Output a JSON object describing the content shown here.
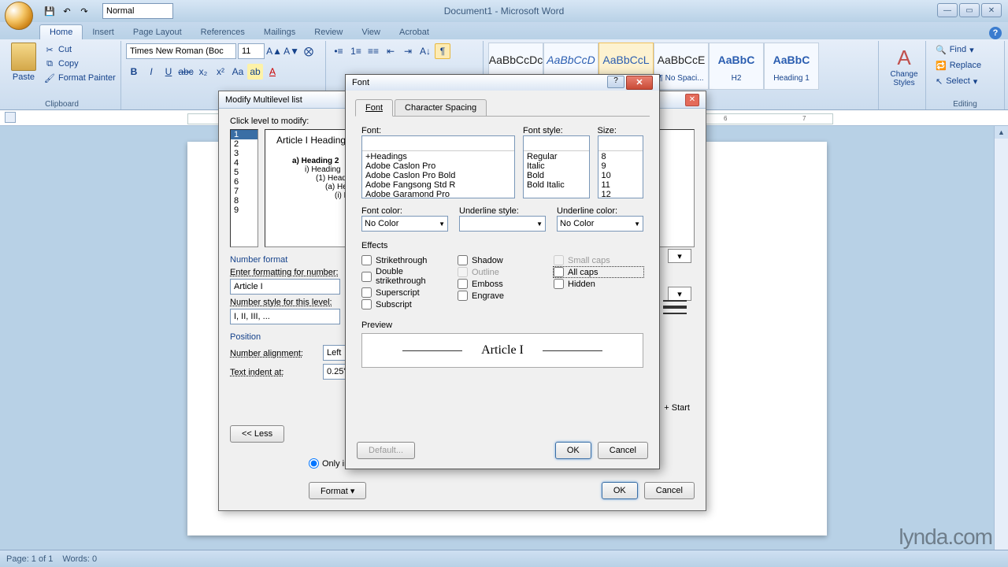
{
  "app": {
    "title": "Document1 - Microsoft Word",
    "qat_style": "Normal"
  },
  "tabs": [
    "Home",
    "Insert",
    "Page Layout",
    "References",
    "Mailings",
    "Review",
    "View",
    "Acrobat"
  ],
  "ribbon": {
    "paste": "Paste",
    "cut": "Cut",
    "copy": "Copy",
    "format_painter": "Format Painter",
    "clipboard": "Clipboard",
    "font_name": "Times New Roman (Boc",
    "font_size": "11",
    "styles": [
      {
        "preview": "AaBbCcDc",
        "name": "",
        "selected": false
      },
      {
        "preview": "AaBbCcD",
        "name": "",
        "selected": false,
        "color": "#2a5db0"
      },
      {
        "preview": "AaBbCcL",
        "name": "",
        "selected": true,
        "color": "#2a5db0"
      },
      {
        "preview": "AaBbCcE",
        "name": "¶ No Spaci...",
        "selected": false
      },
      {
        "preview": "AaBbC",
        "name": "H2",
        "selected": false,
        "color": "#2a5db0"
      },
      {
        "preview": "AaBbC",
        "name": "Heading 1",
        "selected": false,
        "color": "#2a5db0"
      }
    ],
    "change_styles": "Change Styles",
    "find": "Find",
    "replace": "Replace",
    "select": "Select",
    "editing": "Editing"
  },
  "status": {
    "page": "Page: 1 of 1",
    "words": "Words: 0"
  },
  "ml_dialog": {
    "title": "Modify Multilevel list",
    "click_level": "Click level to modify:",
    "levels": [
      "1",
      "2",
      "3",
      "4",
      "5",
      "6",
      "7",
      "8",
      "9"
    ],
    "preview_lines": [
      "Article I Heading 1",
      "a) Heading 2",
      "i) Heading",
      "(1) Head",
      "(a) He",
      "(i) H"
    ],
    "number_format_hdr": "Number format",
    "enter_formatting": "Enter formatting for number:",
    "format_value": "Article I",
    "number_style": "Number style for this level:",
    "number_style_value": "I, II, III, ...",
    "position_hdr": "Position",
    "number_alignment": "Number alignment:",
    "alignment_value": "Left",
    "text_indent": "Text indent at:",
    "indent_value": "0.25\"",
    "less": "<< Less",
    "start": "+ Start",
    "only_in": "Only in",
    "format_btn": "Format",
    "ok": "OK",
    "cancel": "Cancel"
  },
  "font_dialog": {
    "title": "Font",
    "tab_font": "Font",
    "tab_spacing": "Character Spacing",
    "font_lbl": "Font:",
    "font_style_lbl": "Font style:",
    "size_lbl": "Size:",
    "fonts": [
      "+Headings",
      "Adobe Caslon Pro",
      "Adobe Caslon Pro Bold",
      "Adobe Fangsong Std R",
      "Adobe Garamond Pro"
    ],
    "font_styles": [
      "Regular",
      "Italic",
      "Bold",
      "Bold Italic"
    ],
    "sizes": [
      "8",
      "9",
      "10",
      "11",
      "12"
    ],
    "font_color_lbl": "Font color:",
    "font_color": "No Color",
    "underline_style_lbl": "Underline style:",
    "underline_style": "",
    "underline_color_lbl": "Underline color:",
    "underline_color": "No Color",
    "effects_hdr": "Effects",
    "fx_strikethrough": "Strikethrough",
    "fx_dblstrike": "Double strikethrough",
    "fx_superscript": "Superscript",
    "fx_subscript": "Subscript",
    "fx_shadow": "Shadow",
    "fx_outline": "Outline",
    "fx_emboss": "Emboss",
    "fx_engrave": "Engrave",
    "fx_smallcaps": "Small caps",
    "fx_allcaps": "All caps",
    "fx_hidden": "Hidden",
    "preview_hdr": "Preview",
    "preview_text": "Article I",
    "default_btn": "Default...",
    "ok": "OK",
    "cancel": "Cancel"
  },
  "watermark": "lynda.com"
}
